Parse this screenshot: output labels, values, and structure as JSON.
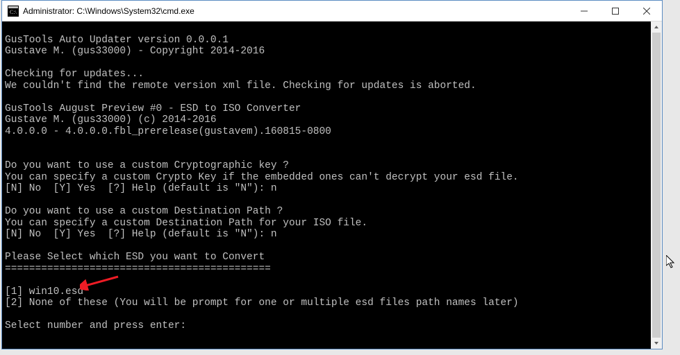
{
  "window": {
    "title": "Administrator: C:\\Windows\\System32\\cmd.exe"
  },
  "console": {
    "lines": [
      "",
      "GusTools Auto Updater version 0.0.0.1",
      "Gustave M. (gus33000) - Copyright 2014-2016",
      "",
      "Checking for updates...",
      "We couldn't find the remote version xml file. Checking for updates is aborted.",
      "",
      "GusTools August Preview #0 - ESD to ISO Converter",
      "Gustave M. (gus33000) (c) 2014-2016",
      "4.0.0.0 - 4.0.0.0.fbl_prerelease(gustavem).160815-0800",
      "",
      "",
      "Do you want to use a custom Cryptographic key ?",
      "You can specify a custom Crypto Key if the embedded ones can't decrypt your esd file.",
      "[N] No  [Y] Yes  [?] Help (default is \"N\"): n",
      "",
      "Do you want to use a custom Destination Path ?",
      "You can specify a custom Destination Path for your ISO file.",
      "[N] No  [Y] Yes  [?] Help (default is \"N\"): n",
      "",
      "Please Select which ESD you want to Convert",
      "============================================",
      "",
      "[1] win10.esd",
      "[2] None of these (You will be prompt for one or multiple esd files path names later)",
      "",
      "Select number and press enter:"
    ]
  },
  "annotation": {
    "arrow_color": "#ee1c25"
  }
}
